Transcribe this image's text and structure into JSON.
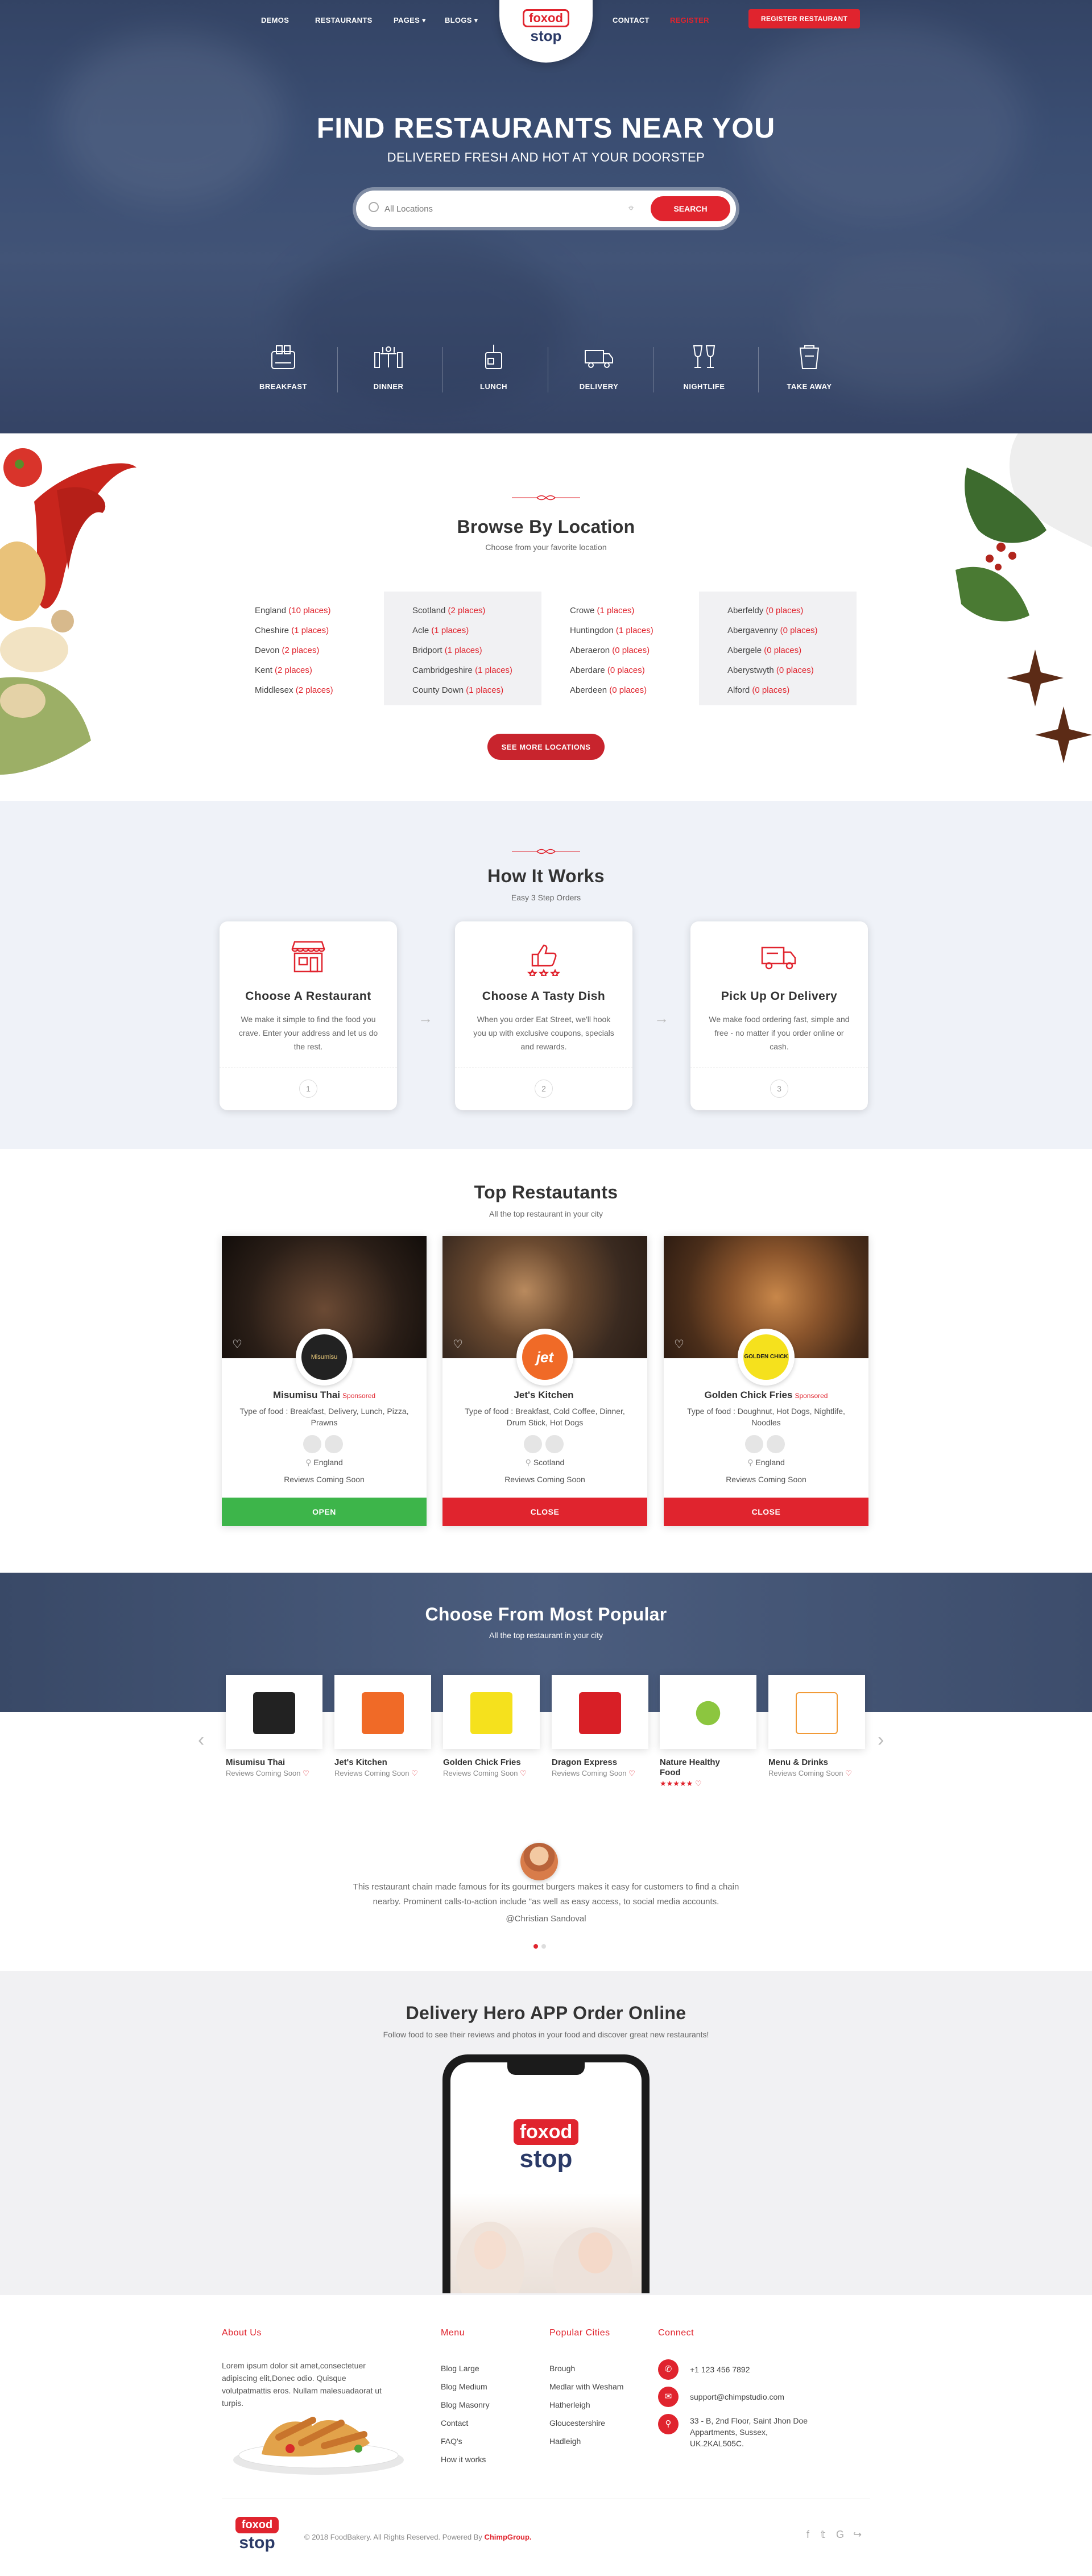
{
  "nav": {
    "left": [
      "DEMOS",
      "RESTAURANTS",
      "PAGES",
      "BLOGS"
    ],
    "right": [
      "CONTACT",
      "REGISTER"
    ],
    "register_button": "REGISTER RESTAURANT",
    "dropdown_icon": "chevron-down-icon"
  },
  "logo": {
    "food": "foxod",
    "stop": "stop"
  },
  "hero": {
    "title": "FIND RESTAURANTS NEAR YOU",
    "subtitle": "DELIVERED FRESH AND HOT AT YOUR DOORSTEP",
    "search_placeholder": "All Locations",
    "search_button": "SEARCH",
    "categories": [
      "BREAKFAST",
      "DINNER",
      "LUNCH",
      "DELIVERY",
      "NIGHTLIFE",
      "TAKE AWAY"
    ]
  },
  "browse": {
    "title": "Browse By Location",
    "subtitle": "Choose from your favorite location",
    "columns": [
      [
        [
          "England",
          "(10 places)"
        ],
        [
          "Cheshire",
          "(1 places)"
        ],
        [
          "Devon",
          "(2 places)"
        ],
        [
          "Kent",
          "(2 places)"
        ],
        [
          "Middlesex",
          "(2 places)"
        ]
      ],
      [
        [
          "Scotland",
          "(2 places)"
        ],
        [
          "Acle",
          "(1 places)"
        ],
        [
          "Bridport",
          "(1 places)"
        ],
        [
          "Cambridgeshire",
          "(1 places)"
        ],
        [
          "County Down",
          "(1 places)"
        ]
      ],
      [
        [
          "Crowe",
          "(1 places)"
        ],
        [
          "Huntingdon",
          "(1 places)"
        ],
        [
          "Aberaeron",
          "(0 places)"
        ],
        [
          "Aberdare",
          "(0 places)"
        ],
        [
          "Aberdeen",
          "(0 places)"
        ]
      ],
      [
        [
          "Aberfeldy",
          "(0 places)"
        ],
        [
          "Abergavenny",
          "(0 places)"
        ],
        [
          "Abergele",
          "(0 places)"
        ],
        [
          "Aberystwyth",
          "(0 places)"
        ],
        [
          "Alford",
          "(0 places)"
        ]
      ]
    ],
    "see_more": "SEE MORE LOCATIONS"
  },
  "how": {
    "title": "How It Works",
    "subtitle": "Easy 3 Step Orders",
    "steps": [
      {
        "title": "Choose A Restaurant",
        "text": "We make it simple to find the food you crave. Enter your address and let us do the rest.",
        "num": "1"
      },
      {
        "title": "Choose A Tasty Dish",
        "text": "When you order Eat Street, we'll hook you up with exclusive coupons, specials and rewards.",
        "num": "2"
      },
      {
        "title": "Pick Up Or Delivery",
        "text": "We make food ordering fast, simple and free - no matter if you order online or cash.",
        "num": "3"
      }
    ]
  },
  "top": {
    "title": "Top Restautants",
    "subtitle": "All the top restaurant in your city",
    "cards": [
      {
        "name": "Misumisu Thai",
        "badge": "Sponsored",
        "type": "Type of food : Breakfast, Delivery, Lunch, Pizza, Prawns",
        "location": "England",
        "reviews": "Reviews Coming Soon",
        "button": "OPEN",
        "btn_color": "#3db54a",
        "logo_text": "Misumisu"
      },
      {
        "name": "Jet's Kitchen",
        "badge": "",
        "type": "Type of food : Breakfast, Cold Coffee, Dinner, Drum Stick, Hot Dogs",
        "location": "Scotland",
        "reviews": "Reviews Coming Soon",
        "button": "CLOSE",
        "btn_color": "#e0242e",
        "logo_text": "jet"
      },
      {
        "name": "Golden Chick Fries",
        "badge": "Sponsored",
        "type": "Type of food : Doughnut, Hot Dogs, Nightlife, Noodles",
        "location": "England",
        "reviews": "Reviews Coming Soon",
        "button": "CLOSE",
        "btn_color": "#e0242e",
        "logo_text": "GOLDEN CHICK"
      }
    ]
  },
  "popular": {
    "title": "Choose From Most Popular",
    "subtitle": "All the top restaurant in your city",
    "items": [
      {
        "name": "Misumisu Thai",
        "reviews": "Reviews Coming Soon",
        "stars": ""
      },
      {
        "name": "Jet's Kitchen",
        "reviews": "Reviews Coming Soon",
        "stars": ""
      },
      {
        "name": "Golden Chick Fries",
        "reviews": "Reviews Coming Soon",
        "stars": ""
      },
      {
        "name": "Dragon Express",
        "reviews": "Reviews Coming Soon",
        "stars": ""
      },
      {
        "name": "Nature Healthy Food",
        "reviews": "",
        "stars": "★★★★★"
      },
      {
        "name": "Menu & Drinks",
        "reviews": "Reviews Coming Soon",
        "stars": ""
      }
    ]
  },
  "testimonial": {
    "text": "This restaurant chain made famous for its gourmet burgers makes it easy for customers to find a chain nearby. Prominent calls-to-action include \"as well as easy access, to social media accounts.",
    "author": "@Christian Sandoval"
  },
  "app": {
    "title": "Delivery Hero APP Order Online",
    "subtitle": "Follow food to see their reviews and photos in your food and discover great new restaurants!"
  },
  "footer": {
    "about_title": "About Us",
    "about_text": "Lorem ipsum dolor sit amet,consectetuer adipiscing elit,Donec odio. Quisque volutpatmattis eros. Nullam malesuadaorat ut turpis.",
    "menu_title": "Menu",
    "menu": [
      "Blog Large",
      "Blog Medium",
      "Blog Masonry",
      "Contact",
      "FAQ's",
      "How it works"
    ],
    "cities_title": "Popular Cities",
    "cities": [
      "Brough",
      "Medlar with Wesham",
      "Hatherleigh",
      "Gloucestershire",
      "Hadleigh"
    ],
    "connect_title": "Connect",
    "phone": "+1 123 456 7892",
    "email": "support@chimpstudio.com",
    "address": "33 - B, 2nd Floor, Saint Jhon Doe Appartments, Sussex, UK.2KAL505C.",
    "copyright": "© 2018 FoodBakery. All Rights Reserved. Powered By",
    "powered": "ChimpGroup."
  },
  "colors": {
    "brand_red": "#e0242e",
    "open_green": "#3db54a",
    "navy": "#2b3a67"
  }
}
